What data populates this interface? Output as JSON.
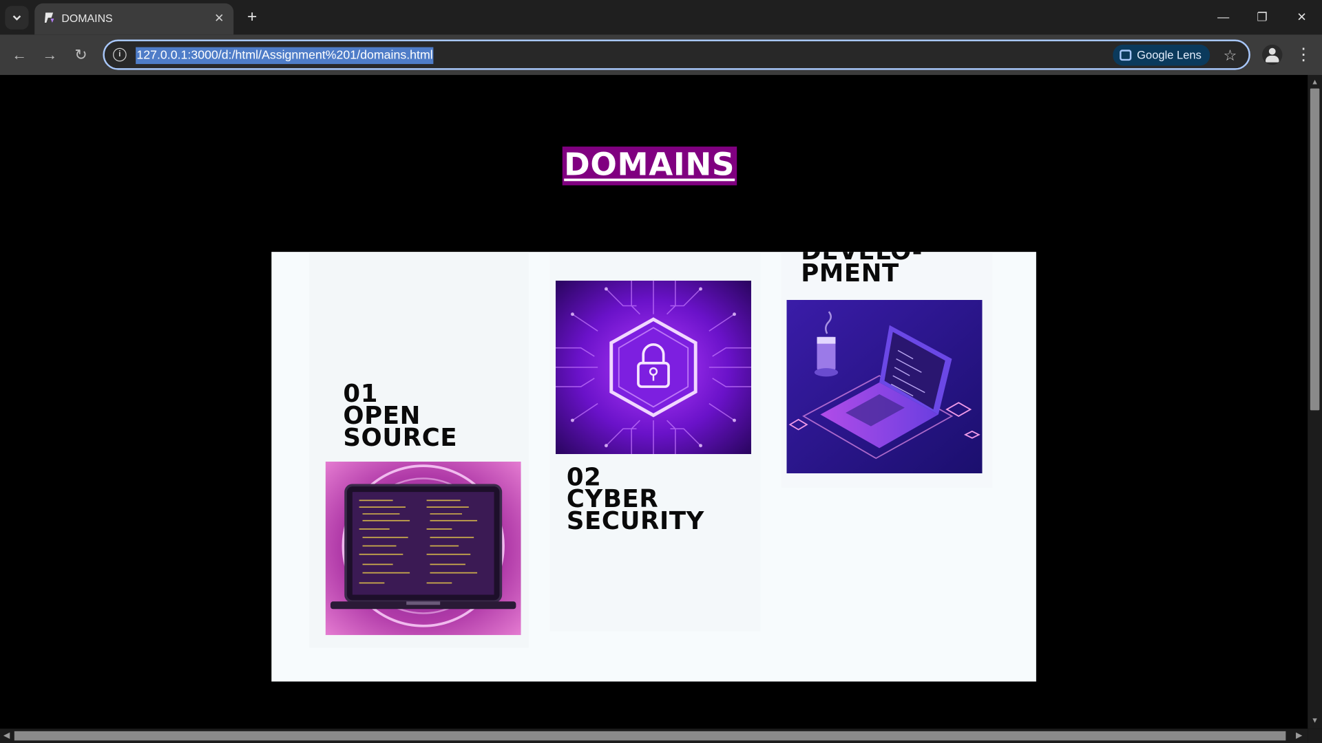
{
  "browser": {
    "tab_title": "DOMAINS",
    "url": "127.0.0.1:3000/d:/html/Assignment%201/domains.html",
    "lens_label": "Google Lens",
    "window_controls": [
      "minimize-icon",
      "restore-icon",
      "close-icon"
    ],
    "accent": "#a8c7fa"
  },
  "page": {
    "heading": "DOMAINS",
    "heading_bg": "#800080",
    "domains": [
      {
        "number": "01",
        "line1": "OPEN",
        "line2": "SOURCE",
        "image": "laptop-code-image"
      },
      {
        "number": "02",
        "line1": "CYBER",
        "line2": "SECURITY",
        "image": "padlock-circuit-image"
      },
      {
        "number": "",
        "line1": "DEVELO-",
        "line2": "PMENT",
        "image": "isometric-laptop-image"
      }
    ]
  }
}
